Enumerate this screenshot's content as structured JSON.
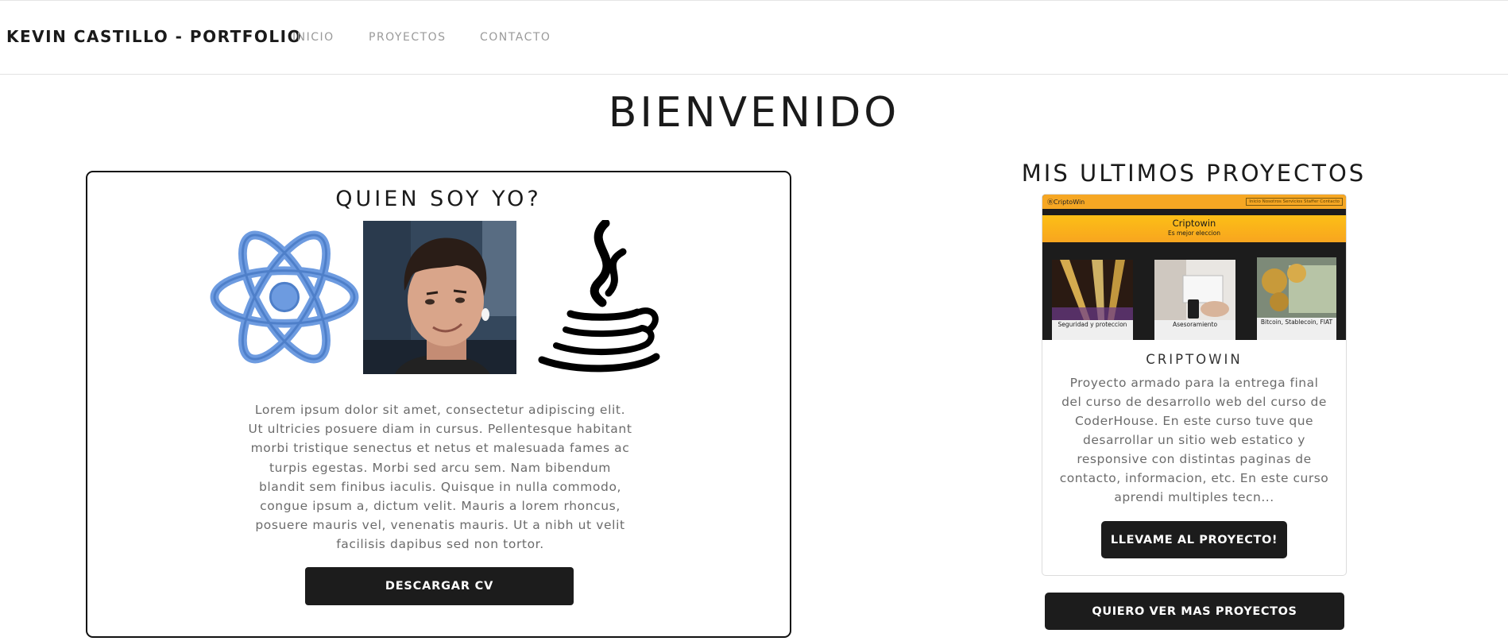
{
  "navbar": {
    "brand": "KEVIN CASTILLO - PORTFOLIO",
    "links": [
      "INICIO",
      "PROYECTOS",
      "CONTACTO"
    ]
  },
  "hero": {
    "title": "BIENVENIDO"
  },
  "about": {
    "title": "QUIEN SOY YO?",
    "images": [
      "react-logo",
      "profile-photo",
      "java-logo"
    ],
    "text": "Lorem ipsum dolor sit amet, consectetur adipiscing elit. Ut ultricies posuere diam in cursus. Pellentesque habitant morbi tristique senectus et netus et malesuada fames ac turpis egestas. Morbi sed arcu sem. Nam bibendum blandit sem finibus iaculis. Quisque in nulla commodo, congue ipsum a, dictum velit. Mauris a lorem rhoncus, posuere mauris vel, venenatis mauris. Ut a nibh ut velit facilisis dapibus sed non tortor.",
    "button_label": "DESCARGAR CV"
  },
  "projects": {
    "title": "MIS ULTIMOS PROYECTOS",
    "items": [
      {
        "thumbnail": {
          "logo": "ⒷCriptoWin",
          "menu": "Inicio  Nosotros  Servicios  Staffer  Contacto",
          "banner_title": "Criptowin",
          "banner_subtitle": "Es mejor eleccion",
          "tiles": [
            "Seguridad y proteccion",
            "Asesoramiento",
            "Bitcoin, Stablecoin, FIAT"
          ]
        },
        "name": "CRIPTOWIN",
        "description": "Proyecto armado para la entrega final del curso de desarrollo web del curso de CoderHouse. En este curso tuve que desarrollar un sitio web estatico y responsive con distintas paginas de contacto, informacion, etc. En este curso aprendi multiples tecn...",
        "button_label": "LLEVAME AL PROYECTO!"
      }
    ],
    "more_button_label": "QUIERO VER MAS PROYECTOS"
  },
  "colors": {
    "accent_dark": "#1c1c1c",
    "react_blue": "#6d9be0",
    "criptowin_orange": "#f8a51f"
  }
}
